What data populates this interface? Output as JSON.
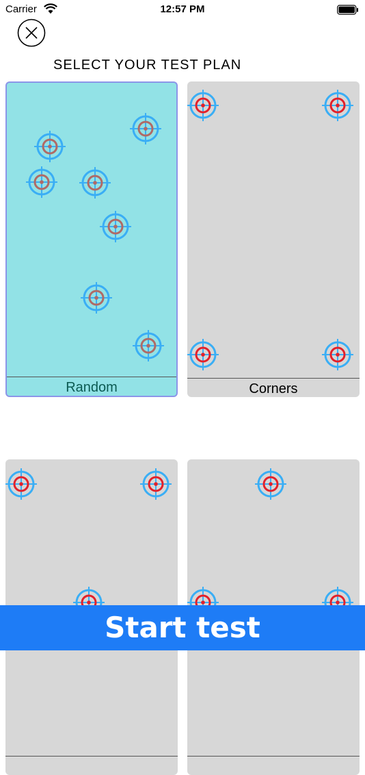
{
  "status_bar": {
    "carrier": "Carrier",
    "time": "12:57 PM"
  },
  "title": "SELECT YOUR TEST PLAN",
  "close_button_icon": "close-circle-icon",
  "plans": [
    {
      "label": "Random",
      "selected": true
    },
    {
      "label": "Corners",
      "selected": false
    },
    {
      "label": "",
      "selected": false
    },
    {
      "label": "",
      "selected": false
    }
  ],
  "start_button": {
    "label": "Start test"
  },
  "colors": {
    "selected_card": "#92e2e6",
    "selected_border": "#8c95e8",
    "card": "#d7d7d7",
    "target_ring": "#3aaef5",
    "target_center_random": "#b06a66",
    "target_center": "#e3202a",
    "start_button": "#1e7cf6"
  }
}
